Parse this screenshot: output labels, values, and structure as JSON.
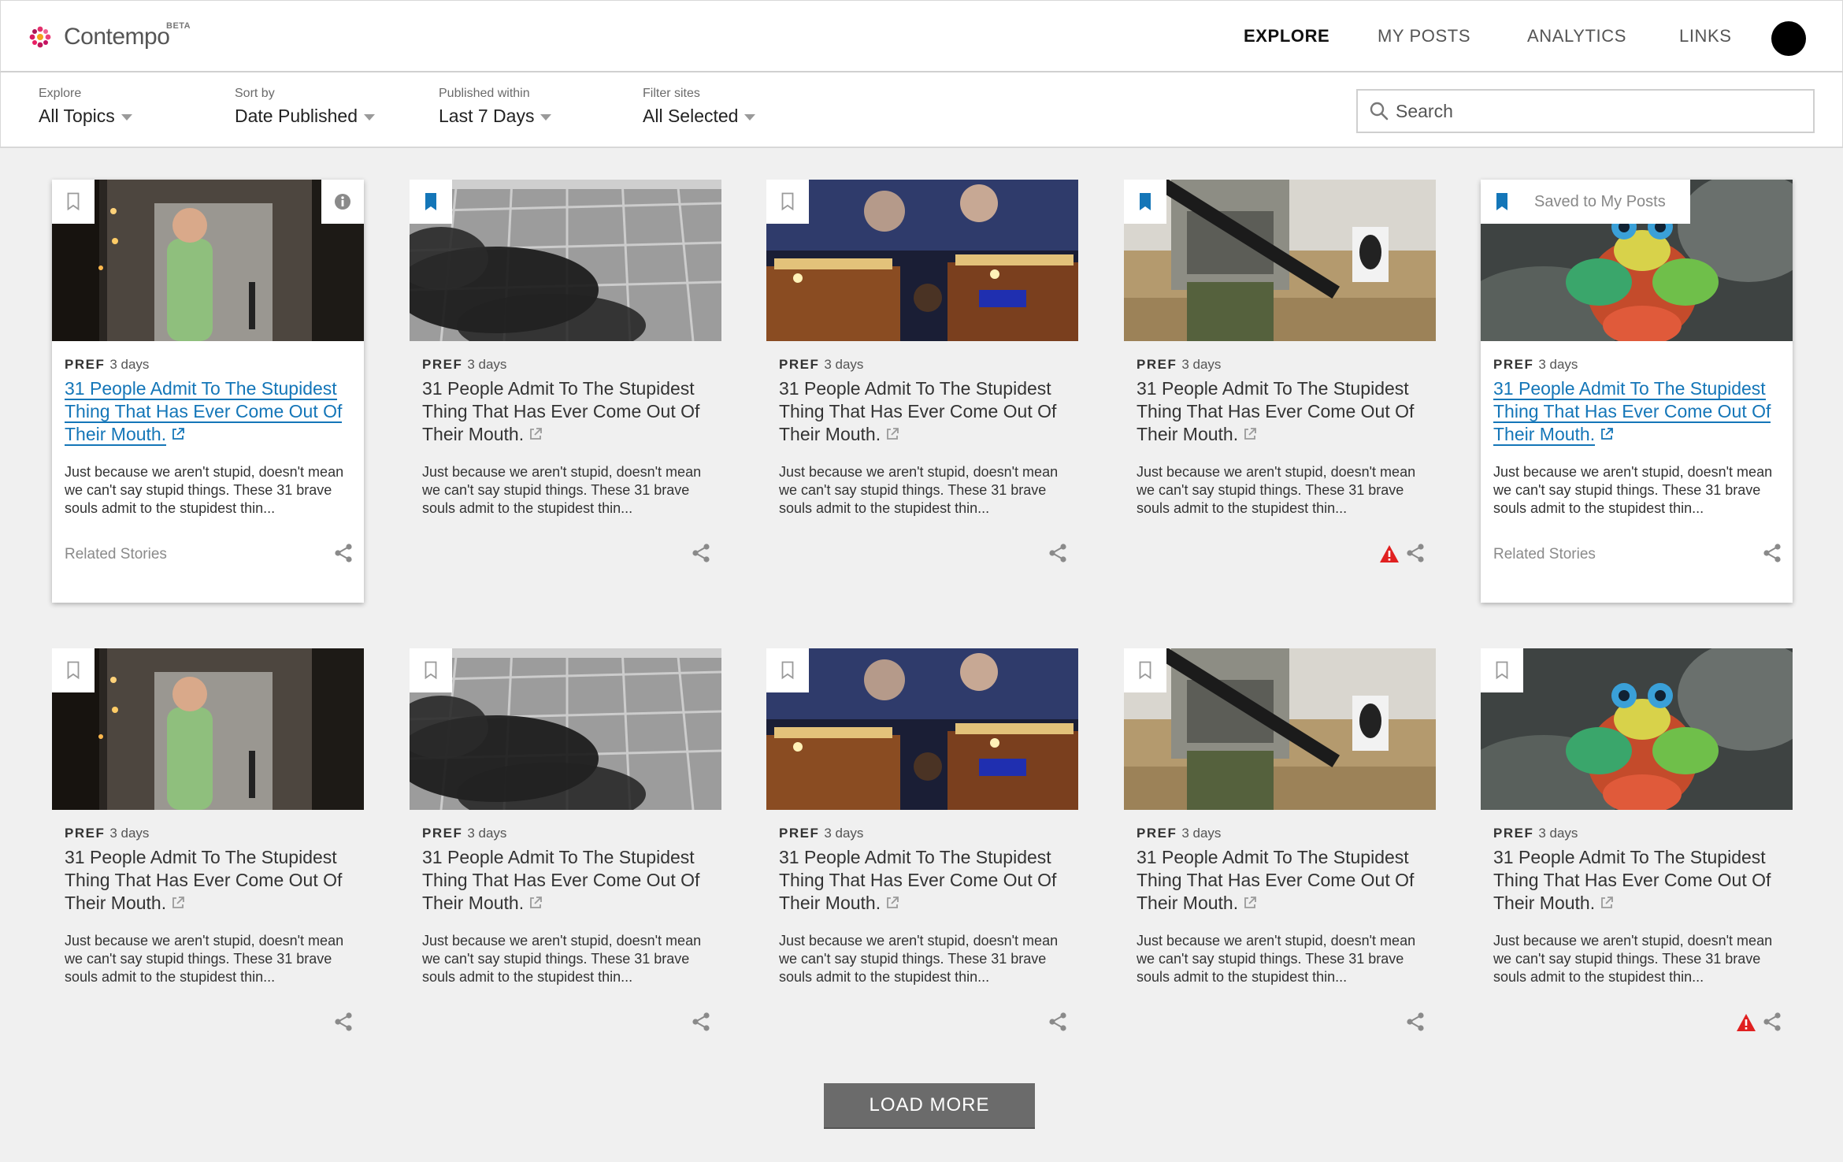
{
  "header": {
    "logo_text": "Contempo",
    "logo_badge": "BETA",
    "nav": [
      {
        "label": "EXPLORE",
        "active": true
      },
      {
        "label": "MY POSTS",
        "active": false
      },
      {
        "label": "ANALYTICS",
        "active": false
      },
      {
        "label": "LINKS",
        "active": false
      }
    ]
  },
  "filters": [
    {
      "label": "Explore",
      "value": "All Topics"
    },
    {
      "label": "Sort by",
      "value": "Date Published"
    },
    {
      "label": "Published within",
      "value": "Last 7 Days"
    },
    {
      "label": "Filter sites",
      "value": "All Selected"
    }
  ],
  "search": {
    "placeholder": "Search"
  },
  "cards": [
    {
      "image": "man-green-shirt-warehouse",
      "bookmarked": false,
      "info": true,
      "saved_label": "",
      "source": "PREF",
      "age": "3 days",
      "title": "31 People Admit To The Stupidest Thing That Has Ever Come Out Of Their Mouth.",
      "description": "Just because we aren't stupid, doesn't mean we can't say stupid things. These 31 brave souls admit to the stupidest thin...",
      "related": "Related Stories",
      "warning": false,
      "linked": true
    },
    {
      "image": "aerial-city-smoke",
      "bookmarked": true,
      "info": false,
      "saved_label": "",
      "source": "PREF",
      "age": "3 days",
      "title": "31 People Admit To The Stupidest Thing That Has Ever Come Out Of Their Mouth.",
      "description": "Just because we aren't stupid, doesn't mean we can't say stupid things. These 31 brave souls admit to the stupidest thin...",
      "related": "",
      "warning": false,
      "linked": false
    },
    {
      "image": "night-market-stalls",
      "bookmarked": false,
      "info": false,
      "saved_label": "",
      "source": "PREF",
      "age": "3 days",
      "title": "31 People Admit To The Stupidest Thing That Has Ever Come Out Of Their Mouth.",
      "description": "Just because we aren't stupid, doesn't mean we can't say stupid things. These 31 brave souls admit to the stupidest thin...",
      "related": "",
      "warning": false,
      "linked": false
    },
    {
      "image": "soldier-rifle-range",
      "bookmarked": true,
      "info": false,
      "saved_label": "",
      "source": "PREF",
      "age": "3 days",
      "title": "31 People Admit To The Stupidest Thing That Has Ever Come Out Of Their Mouth.",
      "description": "Just because we aren't stupid, doesn't mean we can't say stupid things. These 31 brave souls admit to the stupidest thin...",
      "related": "",
      "warning": true,
      "linked": false
    },
    {
      "image": "mantis-shrimp",
      "bookmarked": true,
      "info": false,
      "saved_label": "Saved to My Posts",
      "source": "PREF",
      "age": "3 days",
      "title": "31 People Admit To The Stupidest Thing That Has Ever Come Out Of Their Mouth.",
      "description": "Just because we aren't stupid, doesn't mean we can't say stupid things. These 31 brave souls admit to the stupidest thin...",
      "related": "Related Stories",
      "warning": false,
      "linked": true
    },
    {
      "image": "man-green-shirt-warehouse",
      "bookmarked": false,
      "info": false,
      "saved_label": "",
      "source": "PREF",
      "age": "3 days",
      "title": "31 People Admit To The Stupidest Thing That Has Ever Come Out Of Their Mouth.",
      "description": "Just because we aren't stupid, doesn't mean we can't say stupid things. These 31 brave souls admit to the stupidest thin...",
      "related": "",
      "warning": false,
      "linked": false
    },
    {
      "image": "aerial-city-smoke",
      "bookmarked": false,
      "info": false,
      "saved_label": "",
      "source": "PREF",
      "age": "3 days",
      "title": "31 People Admit To The Stupidest Thing That Has Ever Come Out Of Their Mouth.",
      "description": "Just because we aren't stupid, doesn't mean we can't say stupid things. These 31 brave souls admit to the stupidest thin...",
      "related": "",
      "warning": false,
      "linked": false
    },
    {
      "image": "night-market-stalls",
      "bookmarked": false,
      "info": false,
      "saved_label": "",
      "source": "PREF",
      "age": "3 days",
      "title": "31 People Admit To The Stupidest Thing That Has Ever Come Out Of Their Mouth.",
      "description": "Just because we aren't stupid, doesn't mean we can't say stupid things. These 31 brave souls admit to the stupidest thin...",
      "related": "",
      "warning": false,
      "linked": false
    },
    {
      "image": "soldier-rifle-range",
      "bookmarked": false,
      "info": false,
      "saved_label": "",
      "source": "PREF",
      "age": "3 days",
      "title": "31 People Admit To The Stupidest Thing That Has Ever Come Out Of Their Mouth.",
      "description": "Just because we aren't stupid, doesn't mean we can't say stupid things. These 31 brave souls admit to the stupidest thin...",
      "related": "",
      "warning": false,
      "linked": false
    },
    {
      "image": "mantis-shrimp",
      "bookmarked": false,
      "info": false,
      "saved_label": "",
      "source": "PREF",
      "age": "3 days",
      "title": "31 People Admit To The Stupidest Thing That Has Ever Come Out Of Their Mouth.",
      "description": "Just because we aren't stupid, doesn't mean we can't say stupid things. These 31 brave souls admit to the stupidest thin...",
      "related": "",
      "warning": true,
      "linked": false
    }
  ],
  "load_more_label": "LOAD MORE",
  "colors": {
    "accent": "#1476b8",
    "warning": "#e02020",
    "button": "#6b6b6b"
  }
}
